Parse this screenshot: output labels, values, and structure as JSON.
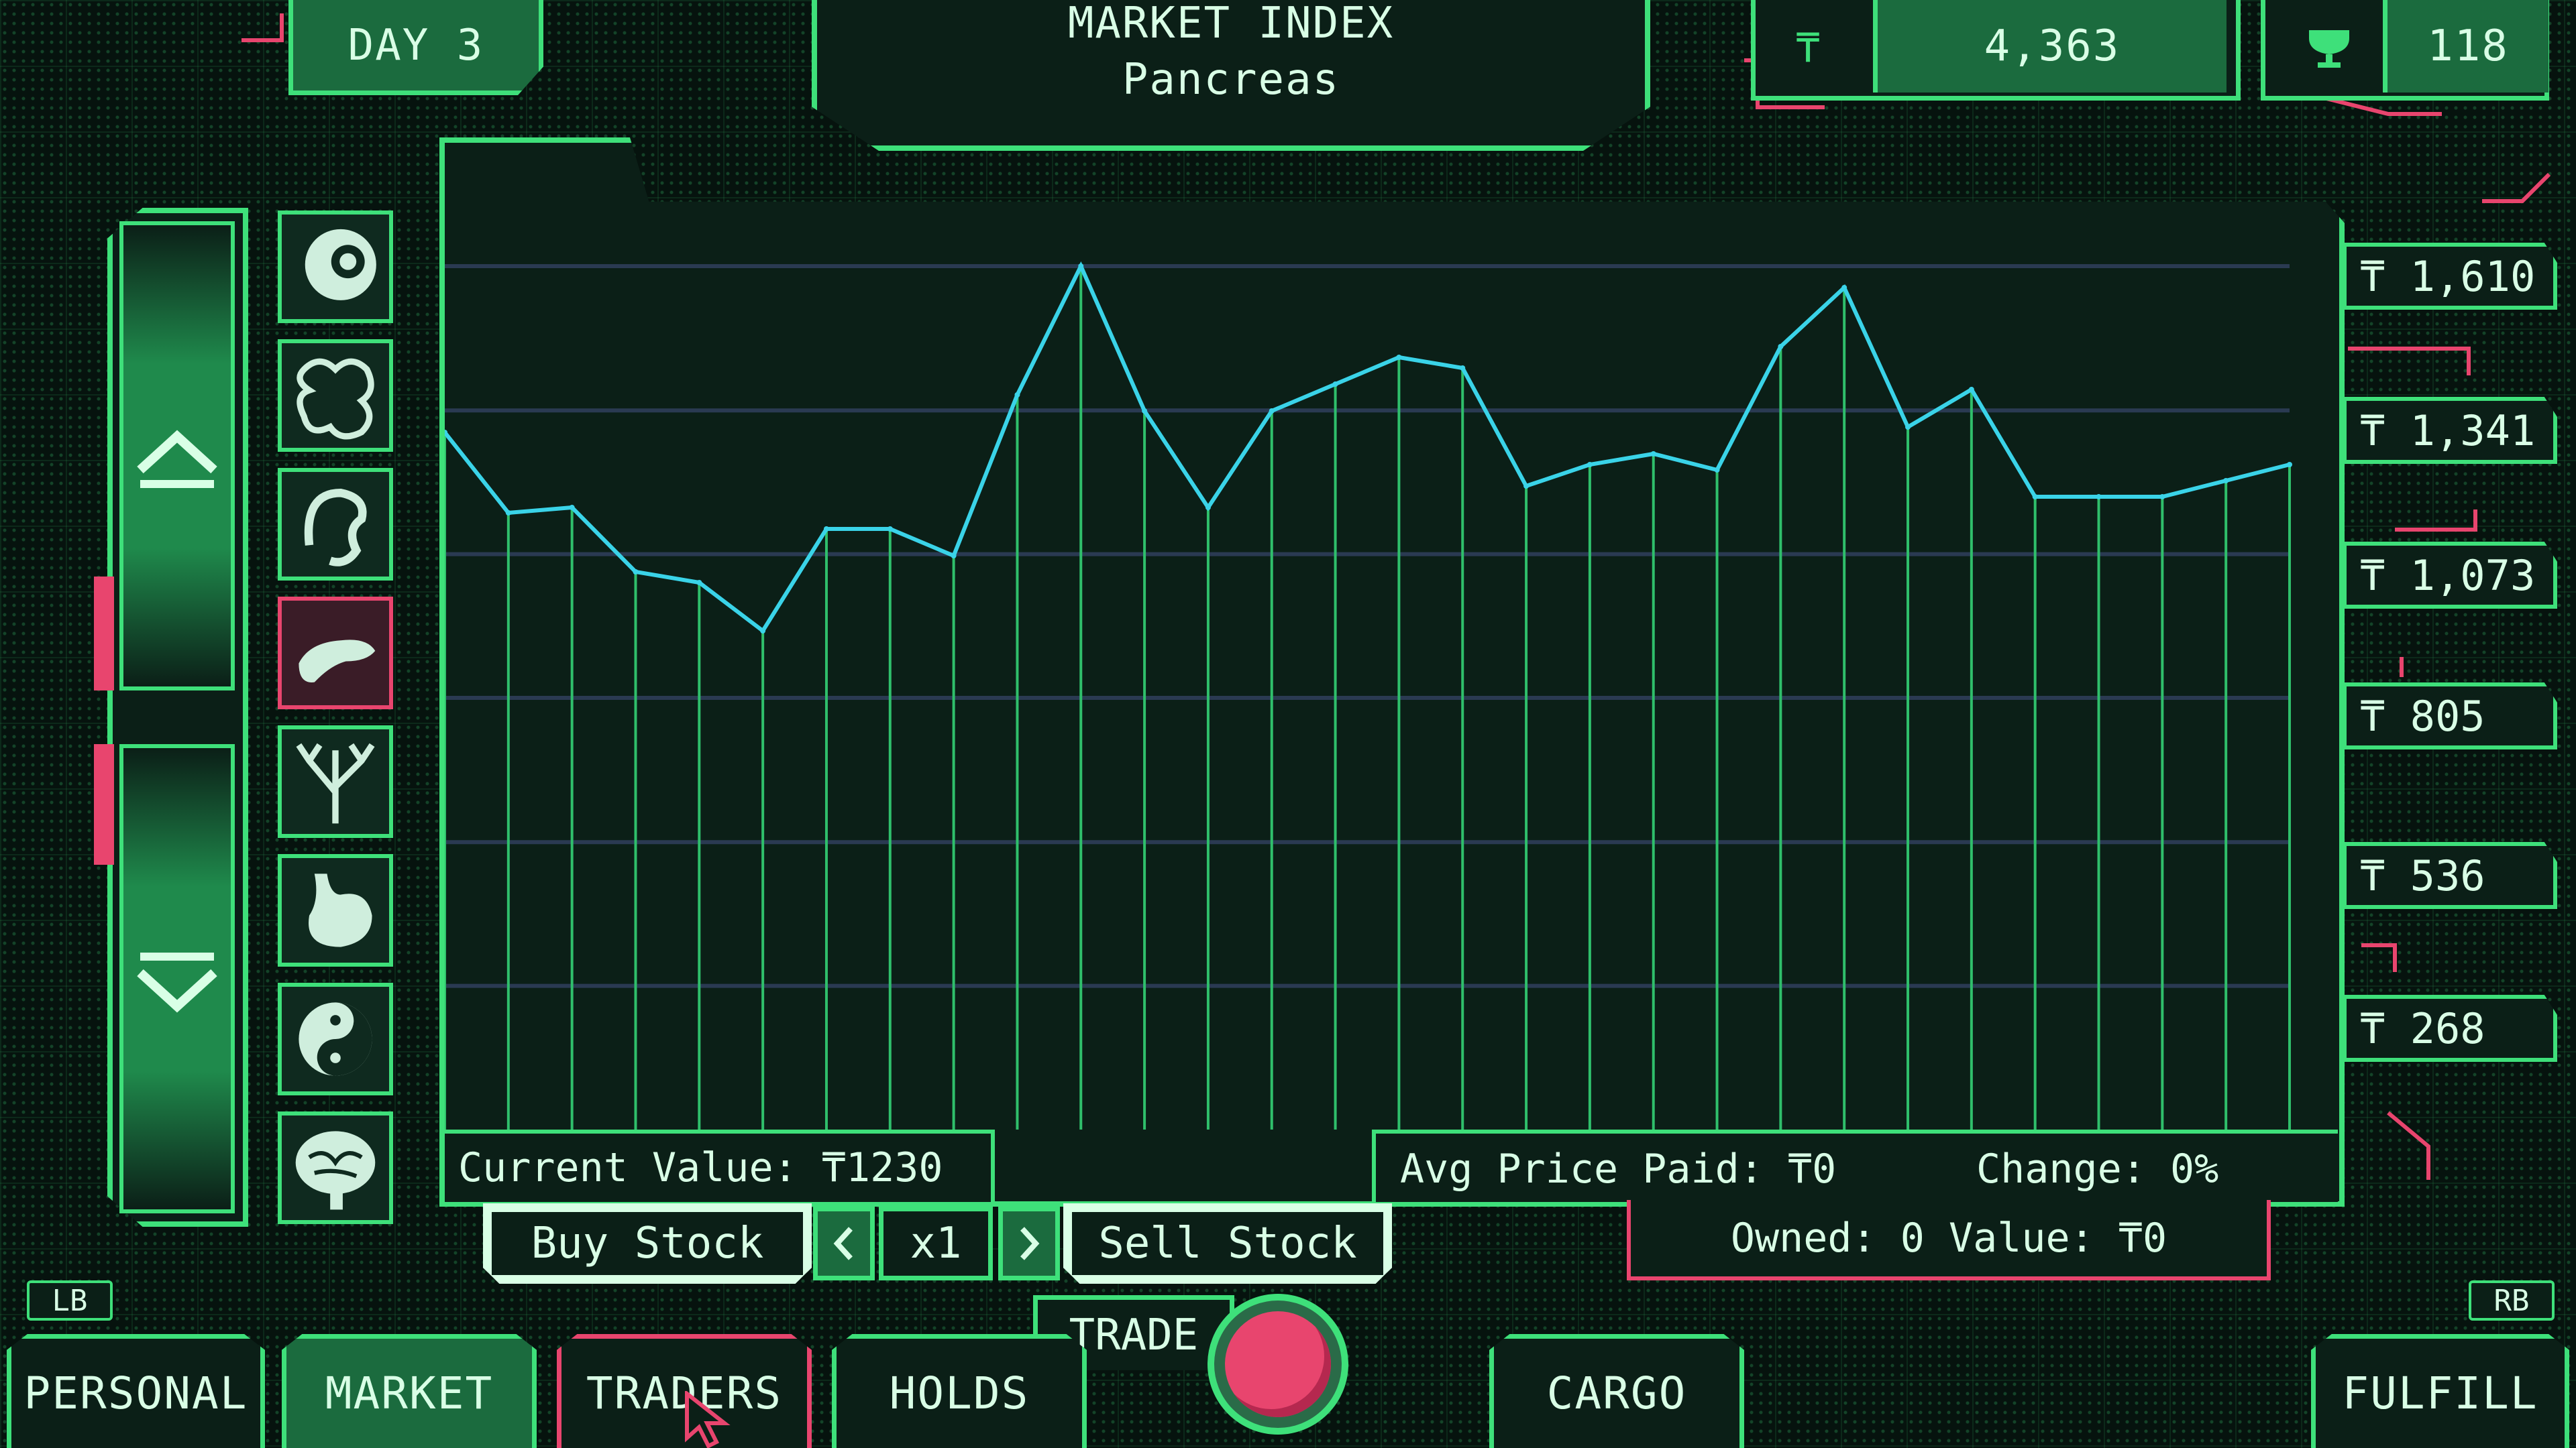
{
  "header": {
    "day": "DAY 3",
    "title": "MARKET INDEX",
    "subtitle": "Pancreas",
    "money": "4,363",
    "trophies": "118",
    "currency_symbol": "₸"
  },
  "chart_data": {
    "type": "line",
    "title": "MARKET INDEX",
    "subtitle": "Pancreas",
    "y_tick_labels": [
      "₸ 1,610",
      "₸ 1,341",
      "₸ 1,073",
      "₸ 805",
      "₸ 536",
      "₸ 268"
    ],
    "y_ticks": [
      1610,
      1341,
      1073,
      805,
      536,
      268
    ],
    "ylim": [
      0,
      1750
    ],
    "x": [
      1,
      2,
      3,
      4,
      5,
      6,
      7,
      8,
      9,
      10,
      11,
      12,
      13,
      14,
      15,
      16,
      17,
      18,
      19,
      20,
      21,
      22,
      23,
      24,
      25,
      26,
      27,
      28,
      29,
      30
    ],
    "series": [
      {
        "values": [
          1300,
          1150,
          1160,
          1040,
          1020,
          930,
          1120,
          1120,
          1070,
          1370,
          1610,
          1340,
          1160,
          1340,
          1390,
          1440,
          1420,
          1200,
          1240,
          1260,
          1230,
          1460,
          1570,
          1310,
          1380,
          1180,
          1180,
          1180,
          1210,
          1240
        ]
      }
    ],
    "grid": true,
    "line_color": "#3ad3e8"
  },
  "stats": {
    "current_value": "Current Value: ₸1230",
    "avg_price": "Avg Price Paid: ₸0",
    "change": "Change: 0%",
    "owned": "Owned: 0 Value: ₸0"
  },
  "trade": {
    "buy_label": "Buy Stock",
    "sell_label": "Sell Stock",
    "quantity": "x1",
    "trade_label": "TRADE"
  },
  "shoulders": {
    "left": "LB",
    "right": "RB"
  },
  "tabs": [
    {
      "label": "PERSONAL"
    },
    {
      "label": "MARKET"
    },
    {
      "label": "TRADERS"
    },
    {
      "label": "HOLDS"
    },
    {
      "label": "CARGO"
    },
    {
      "label": "FULFILL"
    }
  ],
  "organs": [
    {
      "icon": "eye-icon"
    },
    {
      "icon": "intestine-icon"
    },
    {
      "icon": "colon-icon"
    },
    {
      "icon": "pancreas-icon"
    },
    {
      "icon": "lung-branch-icon"
    },
    {
      "icon": "stomach-icon"
    },
    {
      "icon": "yin-yang-icon"
    },
    {
      "icon": "brain-icon"
    }
  ],
  "colors": {
    "accent": "#3ee07a",
    "alert": "#e8456e",
    "line": "#3ad3e8",
    "background": "#06130e"
  }
}
